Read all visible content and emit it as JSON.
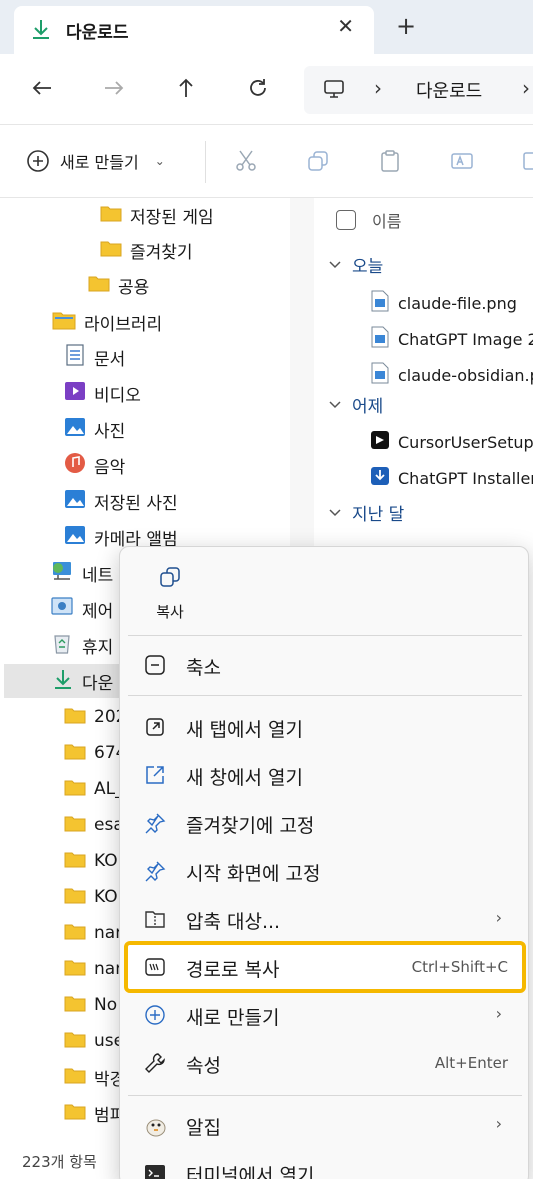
{
  "tab": {
    "title": "다운로드",
    "close": "✕",
    "new_tab": "+"
  },
  "nav": {
    "back": "←",
    "forward": "→",
    "up": "↑",
    "refresh": "⟳"
  },
  "address": {
    "separator": "›",
    "path": "다운로드",
    "separator2": "›"
  },
  "command_bar": {
    "new_label": "새로 만들기",
    "new_chevron": "⌄"
  },
  "sidebar": {
    "items": [
      {
        "label": "저장된 게임",
        "icon": "folder-icon"
      },
      {
        "label": "즐겨찾기",
        "icon": "folder-icon"
      },
      {
        "label": "공용",
        "icon": "folder-icon"
      },
      {
        "label": "라이브러리",
        "icon": "library-folder-icon"
      },
      {
        "label": "문서",
        "icon": "documents-icon"
      },
      {
        "label": "비디오",
        "icon": "videos-icon"
      },
      {
        "label": "사진",
        "icon": "pictures-icon"
      },
      {
        "label": "음악",
        "icon": "music-icon"
      },
      {
        "label": "저장된 사진",
        "icon": "pictures-icon"
      },
      {
        "label": "카메라 앨범",
        "icon": "pictures-icon"
      },
      {
        "label": "네트",
        "icon": "network-icon"
      },
      {
        "label": "제어",
        "icon": "control-panel-icon"
      },
      {
        "label": "휴지",
        "icon": "recycle-bin-icon"
      },
      {
        "label": "다운",
        "icon": "download-icon"
      },
      {
        "label": "202",
        "icon": "folder-icon"
      },
      {
        "label": "674",
        "icon": "folder-icon"
      },
      {
        "label": "AL_",
        "icon": "folder-icon"
      },
      {
        "label": "esa",
        "icon": "folder-icon"
      },
      {
        "label": "KO",
        "icon": "folder-icon"
      },
      {
        "label": "KO",
        "icon": "folder-icon"
      },
      {
        "label": "nar",
        "icon": "folder-icon"
      },
      {
        "label": "nar",
        "icon": "folder-icon"
      },
      {
        "label": "No",
        "icon": "folder-icon"
      },
      {
        "label": "use",
        "icon": "folder-icon"
      },
      {
        "label": "박경",
        "icon": "folder-icon"
      },
      {
        "label": "범피",
        "icon": "folder-icon"
      }
    ],
    "status": "223개 항목"
  },
  "file_list": {
    "column_name": "이름",
    "groups": [
      {
        "label": "오늘",
        "files": [
          "claude-file.png",
          "ChatGPT Image 2",
          "claude-obsidian.p"
        ]
      },
      {
        "label": "어제",
        "files": [
          "CursorUserSetup",
          "ChatGPT Installer"
        ]
      },
      {
        "label": "지난 달",
        "files": []
      }
    ]
  },
  "context_menu": {
    "quick_action": {
      "label": "복사",
      "icon": "copy-icon"
    },
    "items": [
      {
        "label": "축소",
        "icon": "collapse-icon"
      },
      {
        "label": "새 탭에서 열기",
        "icon": "open-new-tab-icon"
      },
      {
        "label": "새 창에서 열기",
        "icon": "open-new-window-icon"
      },
      {
        "label": "즐겨찾기에 고정",
        "icon": "pin-icon"
      },
      {
        "label": "시작 화면에 고정",
        "icon": "pin-icon"
      },
      {
        "label": "압축 대상...",
        "icon": "zip-folder-icon",
        "submenu": "›"
      },
      {
        "label": "경로로 복사",
        "icon": "copy-path-icon",
        "shortcut": "Ctrl+Shift+C",
        "highlighted": true
      },
      {
        "label": "새로 만들기",
        "icon": "new-icon",
        "submenu": "›"
      },
      {
        "label": "속성",
        "icon": "wrench-icon",
        "shortcut": "Alt+Enter"
      },
      {
        "label": "알집",
        "icon": "alzip-icon",
        "submenu": "›"
      },
      {
        "label": "터미널에서 열기",
        "icon": "terminal-icon"
      }
    ]
  },
  "colors": {
    "accent": "#0067c0",
    "highlight": "#f5b800",
    "folder": "#f4c430"
  }
}
